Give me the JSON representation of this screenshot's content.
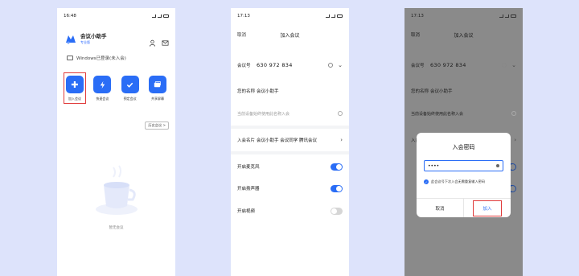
{
  "colors": {
    "accent": "#2a6df6",
    "highlight": "#e03a3a",
    "background": "#dde3fb"
  },
  "phone1": {
    "time": "16:48",
    "app_name": "会议小助手",
    "app_badge": "专业版",
    "device_status": "Windows已登录(未入会)",
    "tiles": [
      {
        "label": "加入会议",
        "icon": "plus-icon"
      },
      {
        "label": "快速会议",
        "icon": "lightning-icon"
      },
      {
        "label": "预定会议",
        "icon": "check-icon"
      },
      {
        "label": "共享屏幕",
        "icon": "screen-share-icon"
      }
    ],
    "history_button": "历史会议 >",
    "empty_text": "暂无会议"
  },
  "phone2": {
    "time": "17:13",
    "cancel": "取消",
    "title": "加入会议",
    "meeting_id_label": "会议号",
    "meeting_id": "630 972 834",
    "name_label": "您的名称",
    "name_value": "会议小助手",
    "remember_option": "当前设备始终使用此名称入会",
    "meeting_name_label": "入会名片",
    "meeting_name_value": "会议小助手 会议同学 腾讯会议",
    "mic_label": "开启麦克风",
    "mic_on": true,
    "speaker_label": "开启扬声器",
    "speaker_on": true,
    "video_label": "开启视频",
    "video_on": false
  },
  "phone3": {
    "time": "17:13",
    "cancel": "取消",
    "title": "加入会议",
    "meeting_id_label": "会议号",
    "meeting_id": "630 972 834",
    "name_label": "您的名称",
    "name_value": "会议小助手",
    "remember_option": "当前设备始终使用此名称入会",
    "meeting_name_label": "入会",
    "dialog": {
      "title": "入会密码",
      "password": "••••",
      "remember_password": "此会议号下次入会无需重复输入密码",
      "cancel": "取消",
      "join": "加入"
    }
  }
}
